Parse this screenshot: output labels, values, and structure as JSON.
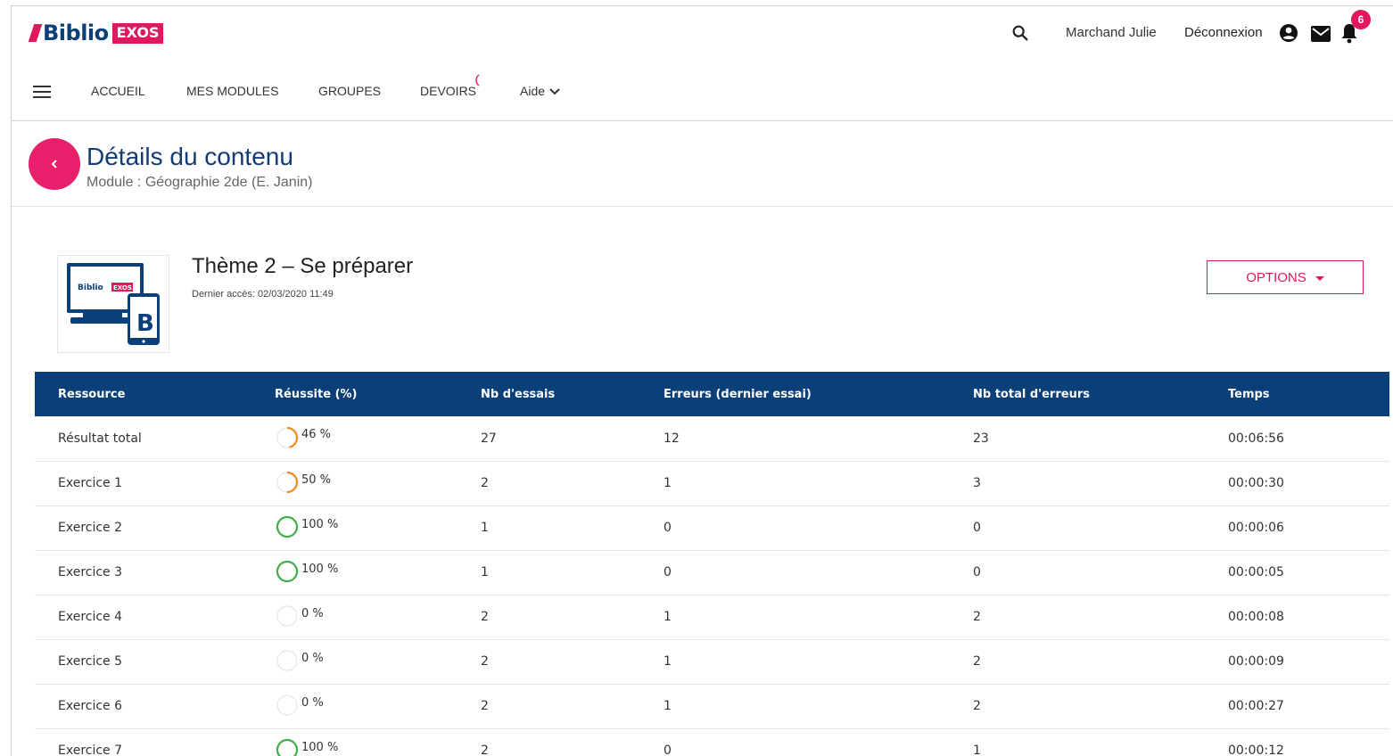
{
  "brand": {
    "name": "Biblio",
    "badge": "EXOS"
  },
  "header": {
    "user_name": "Marchand Julie",
    "logout_label": "Déconnexion",
    "notification_count": "6"
  },
  "nav": {
    "items": [
      {
        "label": "ACCUEIL"
      },
      {
        "label": "MES MODULES"
      },
      {
        "label": "GROUPES"
      },
      {
        "label": "DEVOIRS"
      },
      {
        "label": "Aide"
      }
    ]
  },
  "page": {
    "title": "Détails du contenu",
    "subtitle": "Module : Géographie 2de (E. Janin)"
  },
  "content": {
    "title": "Thème 2 – Se préparer",
    "last_access": "Dernier accès: 02/03/2020 11:49",
    "options_label": "OPTIONS",
    "thumb_logo": "Biblio",
    "thumb_badge": "EXOS",
    "thumb_letter": "B"
  },
  "colors": {
    "brand_blue": "#0b3f78",
    "accent_pink": "#e3175f",
    "partial_orange": "#f08a1c",
    "success_green": "#3fae49",
    "empty_gray": "#e6e6e6"
  },
  "table": {
    "columns": [
      "Ressource",
      "Réussite (%)",
      "Nb d'essais",
      "Erreurs (dernier essai)",
      "Nb total d'erreurs",
      "Temps"
    ],
    "rows": [
      {
        "resource": "Résultat total",
        "success": "46 %",
        "success_value": 46,
        "attempts": "27",
        "last_errors": "12",
        "total_errors": "23",
        "time": "00:06:56"
      },
      {
        "resource": "Exercice 1",
        "success": "50 %",
        "success_value": 50,
        "attempts": "2",
        "last_errors": "1",
        "total_errors": "3",
        "time": "00:00:30"
      },
      {
        "resource": "Exercice 2",
        "success": "100 %",
        "success_value": 100,
        "attempts": "1",
        "last_errors": "0",
        "total_errors": "0",
        "time": "00:00:06"
      },
      {
        "resource": "Exercice 3",
        "success": "100 %",
        "success_value": 100,
        "attempts": "1",
        "last_errors": "0",
        "total_errors": "0",
        "time": "00:00:05"
      },
      {
        "resource": "Exercice 4",
        "success": "0 %",
        "success_value": 0,
        "attempts": "2",
        "last_errors": "1",
        "total_errors": "2",
        "time": "00:00:08"
      },
      {
        "resource": "Exercice 5",
        "success": "0 %",
        "success_value": 0,
        "attempts": "2",
        "last_errors": "1",
        "total_errors": "2",
        "time": "00:00:09"
      },
      {
        "resource": "Exercice 6",
        "success": "0 %",
        "success_value": 0,
        "attempts": "2",
        "last_errors": "1",
        "total_errors": "2",
        "time": "00:00:27"
      },
      {
        "resource": "Exercice 7",
        "success": "100 %",
        "success_value": 100,
        "attempts": "2",
        "last_errors": "0",
        "total_errors": "1",
        "time": "00:00:12"
      }
    ]
  }
}
